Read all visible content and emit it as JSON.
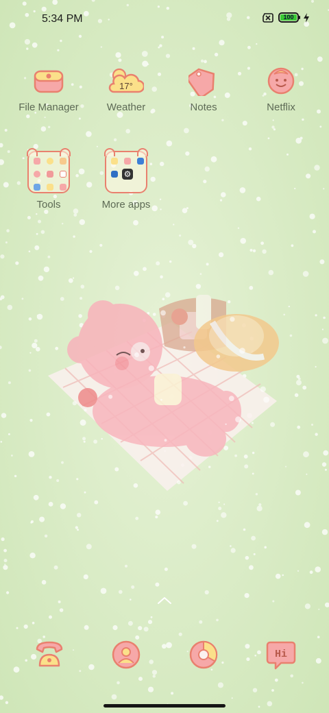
{
  "status_bar": {
    "time": "5:34 PM",
    "battery_level": "100",
    "battery_fraction": 1.0,
    "icons": [
      "no-sim-icon",
      "battery-icon",
      "charging-bolt-icon"
    ]
  },
  "apps": [
    {
      "label": "File Manager",
      "icon": "file-manager-icon"
    },
    {
      "label": "Weather",
      "icon": "weather-icon",
      "temperature": "17°"
    },
    {
      "label": "Notes",
      "icon": "notes-tag-icon"
    },
    {
      "label": "Netflix",
      "icon": "netflix-face-icon"
    }
  ],
  "folders": [
    {
      "label": "Tools",
      "icon": "tools-folder-icon"
    },
    {
      "label": "More apps",
      "icon": "more-apps-folder-icon"
    }
  ],
  "dock": [
    {
      "icon": "phone-icon"
    },
    {
      "icon": "contacts-icon"
    },
    {
      "icon": "browser-icon"
    },
    {
      "icon": "messages-icon",
      "text": "Hi"
    }
  ],
  "colors": {
    "wallpaper_green": "#d7ebc2",
    "icon_stroke": "#e9806e",
    "icon_fill_yellow": "#fbe08a",
    "icon_fill_pink": "#f6a8a8",
    "label_text": "#5d6a55"
  }
}
